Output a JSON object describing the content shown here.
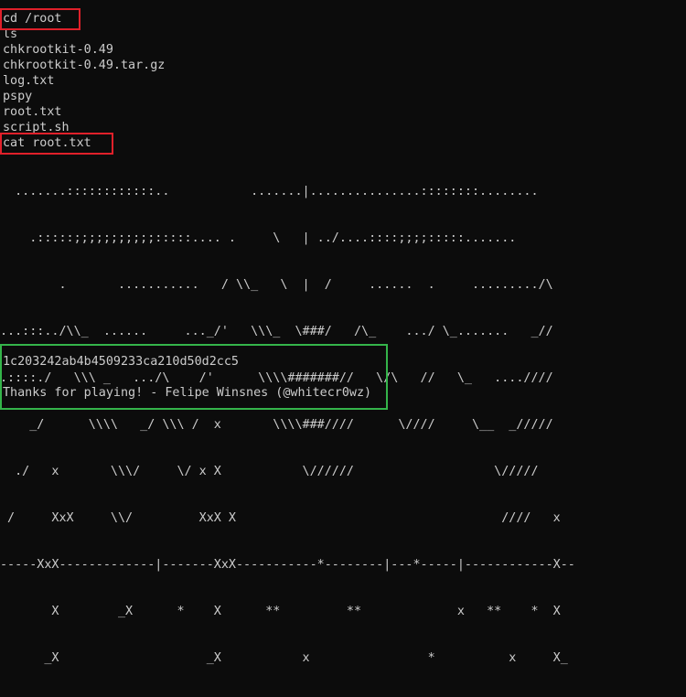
{
  "terminal": {
    "commands": {
      "cd": "cd /root",
      "ls": "ls",
      "cat": "cat root.txt"
    },
    "listing": [
      "chkrootkit-0.49",
      "chkrootkit-0.49.tar.gz",
      "log.txt",
      "pspy",
      "root.txt",
      "script.sh"
    ],
    "ascii_art": [
      "  .......::::::::::::..           .......|...............::::::::........",
      "    .:::::;;;;;;;;;;;:::::.... .     \\   | ../....::::;;;;:::::.......",
      "        .       ...........   / \\\\_   \\  |  /     ......  .     ........./\\",
      "...:::../\\\\_  ......     ..._/'   \\\\\\_  \\###/   /\\_    .../ \\_.......   _//",
      ".::::./   \\\\\\ _   .../\\    /'      \\\\\\\\#######//   \\/\\   //   \\_   ....////",
      "    _/      \\\\\\\\   _/ \\\\\\ /  x       \\\\\\\\###////      \\////     \\__  _/////",
      "  ./   x       \\\\\\/     \\/ x X           \\//////                   \\/////",
      " /     XxX     \\\\/         XxX X                                    ////   x",
      "-----XxX-------------|-------XxX-----------*--------|---*-----|------------X--",
      "       X        _X      *    X      **         **             x   **    *  X",
      "      _X                    _X           x                *          x     X_"
    ],
    "flag": "1c203242ab4b4509233ca210d50d2cc5",
    "thanks": "Thanks for playing! - Felipe Winsnes (@whitecr0wz)"
  },
  "colors": {
    "background": "#0c0c0c",
    "text": "#cccccc",
    "highlight_red": "#e0202a",
    "highlight_green": "#34b44a"
  }
}
